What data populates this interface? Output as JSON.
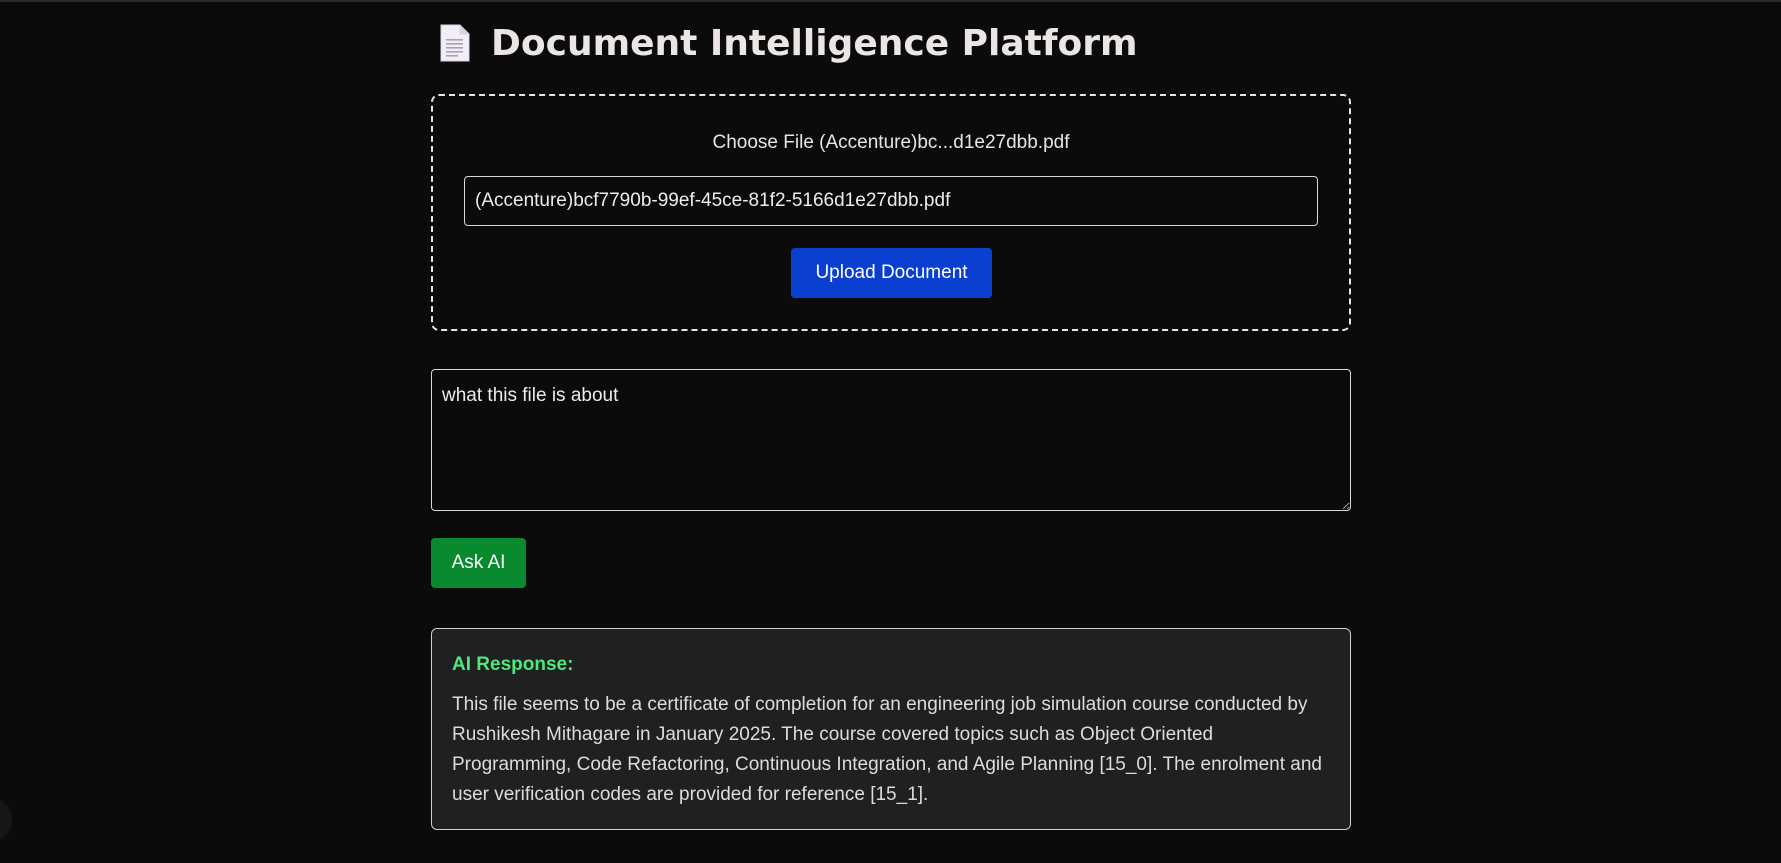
{
  "header": {
    "title": "Document Intelligence Platform",
    "icon": "document-icon"
  },
  "upload": {
    "choose_file_label": "Choose File (Accenture)bc...d1e27dbb.pdf",
    "file_name_value": "(Accenture)bcf7790b-99ef-45ce-81f2-5166d1e27dbb.pdf",
    "upload_button_label": "Upload Document"
  },
  "query": {
    "question_value": "what this file is about",
    "ask_button_label": "Ask AI"
  },
  "response": {
    "title": "AI Response:",
    "text": "This file seems to be a certificate of completion for an engineering job simulation course conducted by Rushikesh Mithagare in January 2025. The course covered topics such as Object Oriented Programming, Code Refactoring, Continuous Integration, and Agile Planning [15_0]. The enrolment and user verification codes are provided for reference [15_1]."
  },
  "colors": {
    "background": "#0b0b0c",
    "upload_button": "#0a3fcf",
    "ask_button": "#0a8a2e",
    "response_title": "#4ee87a",
    "response_bg": "#1f2022"
  }
}
